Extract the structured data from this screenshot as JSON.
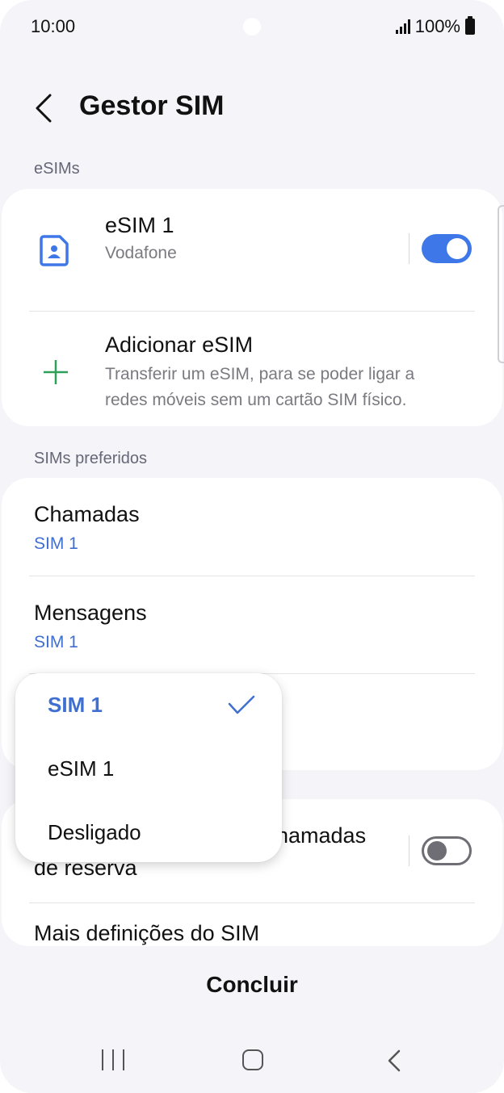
{
  "status_bar": {
    "time": "10:00",
    "battery": "100%"
  },
  "header": {
    "title": "Gestor SIM"
  },
  "esims": {
    "section_label": "eSIMs",
    "esim1": {
      "title": "eSIM 1",
      "carrier": "Vodafone",
      "enabled": true
    },
    "add": {
      "title": "Adicionar eSIM",
      "description_line1": "Transferir um eSIM, para se poder ligar a",
      "description_line2": "redes móveis sem um cartão SIM físico."
    }
  },
  "preferred": {
    "section_label": "SIMs preferidos",
    "calls": {
      "title": "Chamadas",
      "value": "SIM 1"
    },
    "messages": {
      "title": "Mensagens",
      "value": "SIM 1"
    }
  },
  "backup": {
    "title_line1": "namadas",
    "title_line2": "de reserva",
    "enabled": false
  },
  "more": {
    "title": "Mais definições do SIM"
  },
  "dropdown": {
    "options": [
      "SIM 1",
      "eSIM 1",
      "Desligado"
    ],
    "selected": "SIM 1"
  },
  "footer": {
    "done_label": "Concluir"
  },
  "colors": {
    "accent": "#3e77e8",
    "link_blue": "#3f6fd0",
    "background": "#f5f5f9"
  }
}
